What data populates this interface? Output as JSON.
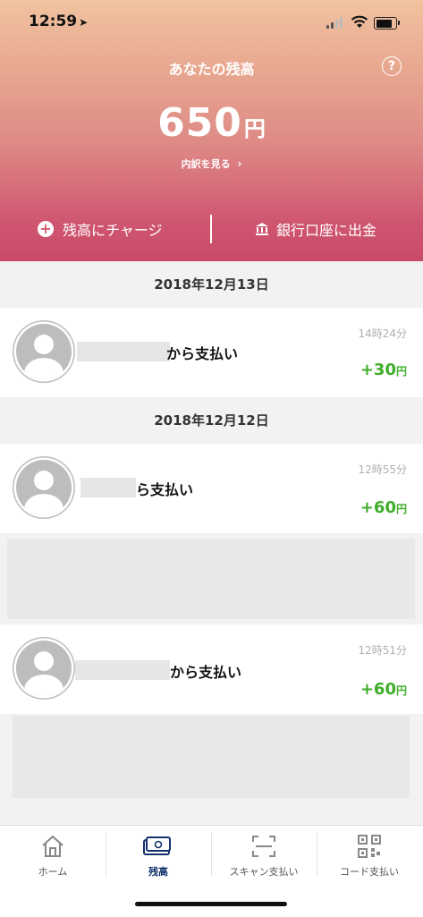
{
  "status_bar": {
    "time": "12:59"
  },
  "header": {
    "title": "あなたの残高",
    "help_label": "?",
    "balance_amount": "650",
    "balance_unit": "円",
    "breakdown_link": "内訳を見る",
    "charge_label": "残高にチャージ",
    "withdraw_label": "銀行口座に出金"
  },
  "transactions": [
    {
      "date": "2018年12月13日",
      "payee_suffix": "から支払い",
      "time": "14時24分",
      "amount": "+30",
      "unit": "円"
    },
    {
      "date": "2018年12月12日",
      "payee_suffix": "ら支払い",
      "time": "12時55分",
      "amount": "+60",
      "unit": "円"
    },
    {
      "payee_suffix": "から支払い",
      "time": "12時51分",
      "amount": "+60",
      "unit": "円"
    }
  ],
  "tabbar": {
    "home": "ホーム",
    "balance": "残高",
    "scan": "スキャン支払い",
    "code": "コード支払い"
  },
  "colors": {
    "accent_green": "#3fae2a",
    "active_tab": "#13316b",
    "header_top": "#f1c3a0",
    "header_bottom": "#c94a68"
  }
}
